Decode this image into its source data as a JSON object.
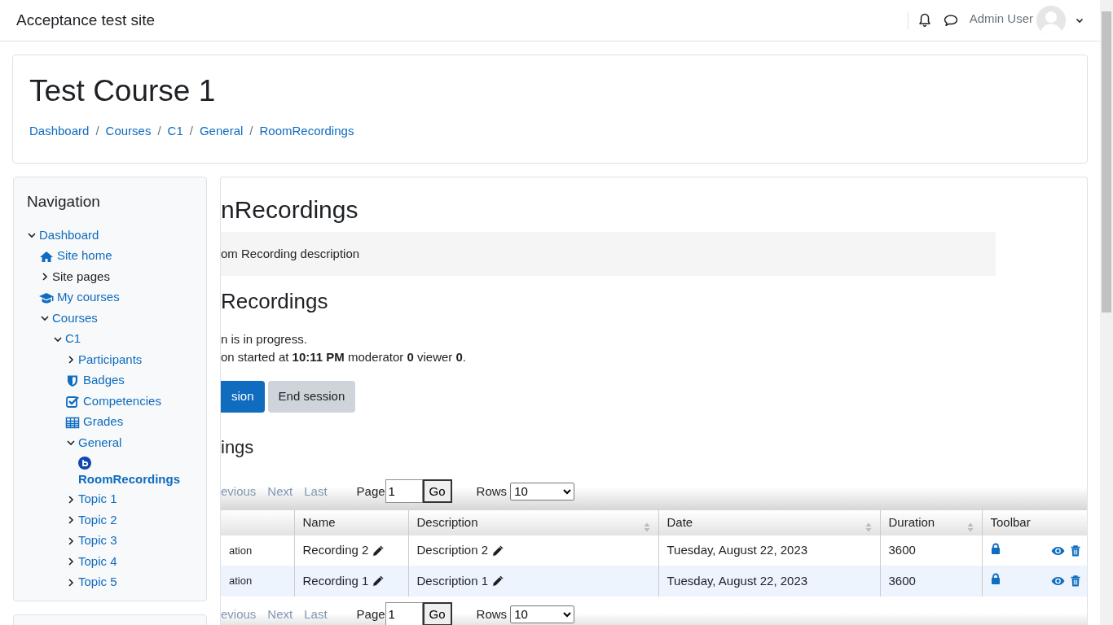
{
  "site_name": "Acceptance test site",
  "user_menu": {
    "name": "Admin User"
  },
  "course": {
    "title": "Test Course 1",
    "breadcrumbs": [
      "Dashboard",
      "Courses",
      "C1",
      "General",
      "RoomRecordings"
    ],
    "separator": "/"
  },
  "navigation": {
    "title": "Navigation",
    "items": [
      {
        "label": "Dashboard",
        "kind": "node",
        "expanded": true,
        "selected": false,
        "children": [
          {
            "label": "Site home",
            "kind": "home",
            "selected": false
          },
          {
            "label": "Site pages",
            "kind": "text",
            "expanded": false,
            "selected": false
          },
          {
            "label": "My courses",
            "kind": "mycourses",
            "selected": false
          },
          {
            "label": "Courses",
            "kind": "node",
            "expanded": true,
            "selected": false,
            "children": [
              {
                "label": "C1",
                "kind": "node",
                "expanded": true,
                "selected": false,
                "children": [
                  {
                    "label": "Participants",
                    "kind": "node",
                    "expanded": false,
                    "selected": false
                  },
                  {
                    "label": "Badges",
                    "kind": "badges",
                    "selected": false
                  },
                  {
                    "label": "Competencies",
                    "kind": "competencies",
                    "selected": false
                  },
                  {
                    "label": "Grades",
                    "kind": "grades",
                    "selected": false
                  },
                  {
                    "label": "General",
                    "kind": "node",
                    "expanded": true,
                    "selected": false,
                    "children": [
                      {
                        "label": "RoomRecordings",
                        "kind": "activity",
                        "selected": true
                      }
                    ]
                  },
                  {
                    "label": "Topic 1",
                    "kind": "node",
                    "expanded": false,
                    "selected": false
                  },
                  {
                    "label": "Topic 2",
                    "kind": "node",
                    "expanded": false,
                    "selected": false
                  },
                  {
                    "label": "Topic 3",
                    "kind": "node",
                    "expanded": false,
                    "selected": false
                  },
                  {
                    "label": "Topic 4",
                    "kind": "node",
                    "expanded": false,
                    "selected": false
                  },
                  {
                    "label": "Topic 5",
                    "kind": "node",
                    "expanded": false,
                    "selected": false
                  }
                ]
              }
            ]
          }
        ]
      }
    ]
  },
  "activity": {
    "heading": "nRecordings",
    "description": "om Recording description",
    "room": {
      "heading": "Recordings",
      "status": "n is in progress.",
      "details": "on started at **10:11 PM** moderator **0** viewer **0**.",
      "buttons": [
        {
          "label": "sion",
          "kind": "primary"
        },
        {
          "label": "End session",
          "kind": "secondary"
        }
      ]
    },
    "recordings": {
      "heading": "ings",
      "pager_top": {
        "links": [
          {
            "label": "evious",
            "disabled": true
          },
          {
            "label": "Next",
            "disabled": true
          },
          {
            "label": "Last",
            "disabled": true
          }
        ],
        "page_label": "Page",
        "page_value": "1",
        "go": "Go",
        "rows_label": "Rows",
        "rows_value": "10"
      },
      "table": {
        "columns": [
          {
            "sortable": false,
            "kind": "text"
          },
          {
            "label": "Name",
            "sortable": false,
            "kind": "editable"
          },
          {
            "label": "Description",
            "sortable": true,
            "kind": "editable"
          },
          {
            "label": "Date",
            "sortable": true,
            "kind": "text"
          },
          {
            "label": "Duration",
            "sortable": true,
            "kind": "text"
          },
          {
            "label": "Toolbar",
            "sortable": false,
            "kind": "toolbar"
          }
        ],
        "rows": [
          {
            "cells": [
              "ation",
              "Recording 2",
              "Description 2",
              "Tuesday, August 22, 2023",
              "3600"
            ],
            "highlighted": false
          },
          {
            "cells": [
              "ation",
              "Recording 1",
              "Description 1",
              "Tuesday, August 22, 2023",
              "3600"
            ],
            "highlighted": true
          }
        ]
      },
      "pager_bottom": {
        "links": [
          {
            "label": "evious",
            "disabled": true
          },
          {
            "label": "Next",
            "disabled": true
          },
          {
            "label": "Last",
            "disabled": true
          }
        ],
        "page_label": "Page",
        "page_value": "1",
        "go": "Go",
        "rows_label": "Rows",
        "rows_value": "10"
      }
    }
  }
}
